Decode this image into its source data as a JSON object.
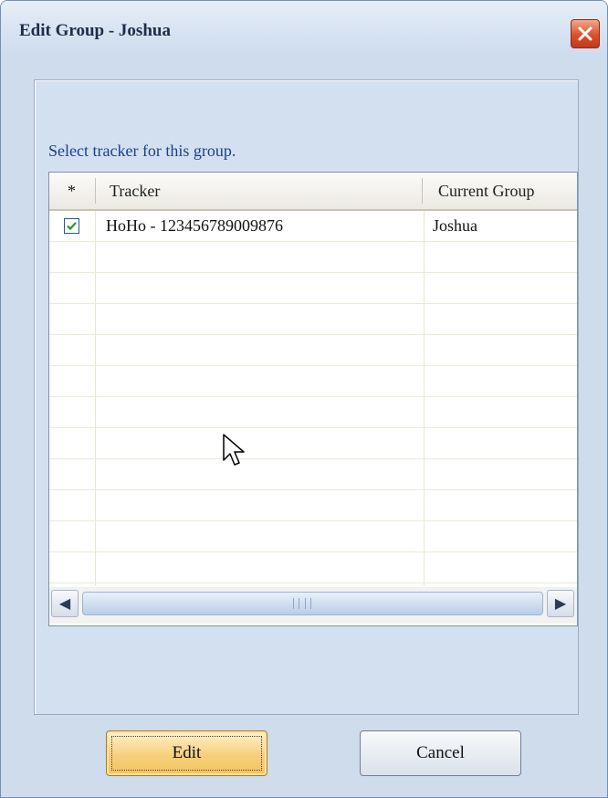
{
  "window": {
    "title": "Edit Group - Joshua"
  },
  "dialog": {
    "prompt": "Select tracker for this group."
  },
  "grid": {
    "columns": [
      "*",
      "Tracker",
      "Current Group"
    ],
    "rows": [
      {
        "checked": true,
        "tracker": "HoHo - 123456789009876",
        "group": "Joshua"
      }
    ],
    "horizontal_scrollbar": true
  },
  "buttons": {
    "edit": "Edit",
    "cancel": "Cancel"
  },
  "colors": {
    "title_text": "#1d2c47",
    "prompt_text": "#1c3f8c",
    "close_button": "#d8512a",
    "edit_button": "#f7cf7c",
    "checkbox_mark": "#1f9a2e"
  },
  "icons": [
    "close-icon",
    "checkmark-icon",
    "arrow-left-icon",
    "arrow-right-icon",
    "mouse-cursor-icon"
  ]
}
